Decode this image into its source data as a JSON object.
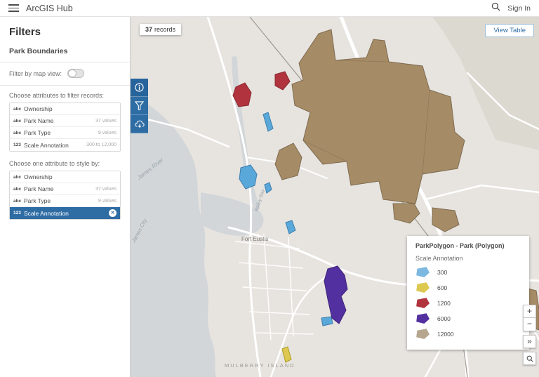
{
  "topbar": {
    "app_title": "ArcGIS Hub",
    "sign_in_label": "Sign In"
  },
  "sidebar": {
    "title": "Filters",
    "subtitle": "Park Boundaries",
    "map_view_toggle_label": "Filter by map view:",
    "filter_section_label": "Choose attributes to filter records:",
    "style_section_label": "Choose one attribute to style by:",
    "filter_attributes": [
      {
        "type": "abc",
        "label": "Ownership",
        "meta": ""
      },
      {
        "type": "abc",
        "label": "Park Name",
        "meta": "37 values"
      },
      {
        "type": "abc",
        "label": "Park Type",
        "meta": "9 values"
      },
      {
        "type": "123",
        "label": "Scale Annotation",
        "meta": "300 to 12,000"
      }
    ],
    "style_attributes": [
      {
        "type": "abc",
        "label": "Ownership",
        "meta": ""
      },
      {
        "type": "abc",
        "label": "Park Name",
        "meta": "37 values"
      },
      {
        "type": "abc",
        "label": "Park Type",
        "meta": "9 values"
      },
      {
        "type": "123",
        "label": "Scale Annotation",
        "meta": ""
      }
    ],
    "selected_style_attribute": "Scale Annotation"
  },
  "map": {
    "records_count": "37",
    "records_label": "records",
    "view_table_label": "View Table",
    "labels": {
      "river": "James River",
      "james_city": "James City",
      "bay": "Bailey Bay",
      "fort": "Fort Eustis",
      "island": "MULBERRY ISLAND"
    },
    "legend": {
      "title": "ParkPolygon - Park (Polygon)",
      "field": "Scale Annotation",
      "items": [
        {
          "label": "300",
          "color": "#7db8e0"
        },
        {
          "label": "600",
          "color": "#ddc94f"
        },
        {
          "label": "1200",
          "color": "#b0333e"
        },
        {
          "label": "6000",
          "color": "#53309f"
        },
        {
          "label": "12000",
          "color": "#b7a68e"
        }
      ]
    },
    "controls": {
      "zoom_in": "+",
      "zoom_out": "−",
      "collapse": "»"
    }
  }
}
